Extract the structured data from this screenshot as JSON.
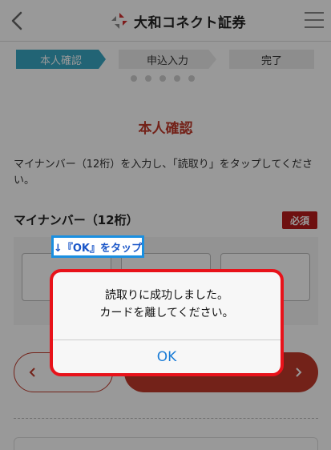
{
  "header": {
    "brand": "大和コネクト証券",
    "back_icon": "chevron-left-icon",
    "menu_icon": "hamburger-icon"
  },
  "steps": [
    {
      "label": "本人確認",
      "active": true
    },
    {
      "label": "申込入力",
      "active": false
    },
    {
      "label": "完了",
      "active": false
    }
  ],
  "main": {
    "title": "本人確認",
    "instruction": "マイナンバー（12桁）を入力し、「読取り」をタップしてください。",
    "field_label": "マイナンバー（12桁）",
    "required_badge": "必須"
  },
  "annotation": {
    "text": "↓『OK』をタップ"
  },
  "dialog": {
    "line1": "読取りに成功しました。",
    "line2": "カードを離してください。",
    "ok_label": "OK"
  },
  "colors": {
    "accent": "#c0392b",
    "step_active": "#3aa7c4",
    "dialog_highlight": "#e8121a",
    "callout_border": "#1a8fe0",
    "ok_text": "#1a7cd6"
  }
}
